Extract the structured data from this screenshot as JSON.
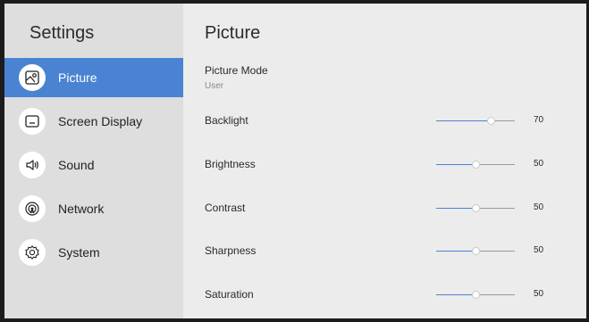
{
  "sidebar": {
    "title": "Settings",
    "items": [
      {
        "label": "Picture",
        "icon": "picture-icon",
        "active": true
      },
      {
        "label": "Screen Display",
        "icon": "screen-display-icon",
        "active": false
      },
      {
        "label": "Sound",
        "icon": "sound-icon",
        "active": false
      },
      {
        "label": "Network",
        "icon": "network-icon",
        "active": false
      },
      {
        "label": "System",
        "icon": "system-icon",
        "active": false
      }
    ]
  },
  "main": {
    "title": "Picture",
    "picture_mode": {
      "label": "Picture Mode",
      "value": "User"
    },
    "settings": [
      {
        "label": "Backlight",
        "value": "70",
        "level": 0.7
      },
      {
        "label": "Brightness",
        "value": "50",
        "level": 0.5
      },
      {
        "label": "Contrast",
        "value": "50",
        "level": 0.5
      },
      {
        "label": "Sharpness",
        "value": "50",
        "level": 0.5
      },
      {
        "label": "Saturation",
        "value": "50",
        "level": 0.5
      }
    ]
  },
  "colors": {
    "accent": "#4a83d2",
    "sidebar_bg": "#dedede",
    "content_bg": "#ececec"
  }
}
